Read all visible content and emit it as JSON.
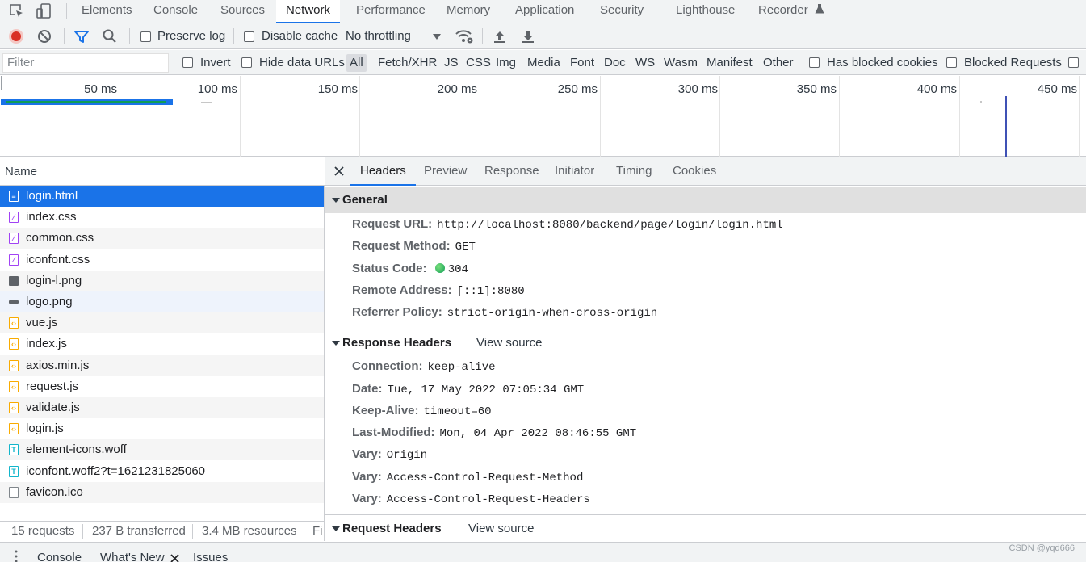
{
  "main_tabs": [
    "Elements",
    "Console",
    "Sources",
    "Network",
    "Performance",
    "Memory",
    "Application",
    "Security",
    "Lighthouse",
    "Recorder"
  ],
  "toolbar": {
    "preserve_log": "Preserve log",
    "disable_cache": "Disable cache",
    "throttling": "No throttling"
  },
  "filterbar": {
    "placeholder": "Filter",
    "invert": "Invert",
    "hide_data_urls": "Hide data URLs",
    "types": [
      "All",
      "Fetch/XHR",
      "JS",
      "CSS",
      "Img",
      "Media",
      "Font",
      "Doc",
      "WS",
      "Wasm",
      "Manifest",
      "Other"
    ],
    "has_blocked_cookies": "Has blocked cookies",
    "blocked_requests": "Blocked Requests"
  },
  "timeline": {
    "ticks": [
      "50 ms",
      "100 ms",
      "150 ms",
      "200 ms",
      "250 ms",
      "300 ms",
      "350 ms",
      "400 ms",
      "450 ms"
    ]
  },
  "request_list": {
    "header": "Name",
    "requests": [
      {
        "name": "login.html",
        "type": "doc"
      },
      {
        "name": "index.css",
        "type": "css"
      },
      {
        "name": "common.css",
        "type": "css"
      },
      {
        "name": "iconfont.css",
        "type": "css"
      },
      {
        "name": "login-l.png",
        "type": "img"
      },
      {
        "name": "logo.png",
        "type": "img"
      },
      {
        "name": "vue.js",
        "type": "js"
      },
      {
        "name": "index.js",
        "type": "js"
      },
      {
        "name": "axios.min.js",
        "type": "js"
      },
      {
        "name": "request.js",
        "type": "js"
      },
      {
        "name": "validate.js",
        "type": "js"
      },
      {
        "name": "login.js",
        "type": "js"
      },
      {
        "name": "element-icons.woff",
        "type": "font"
      },
      {
        "name": "iconfont.woff2?t=1621231825060",
        "type": "font"
      },
      {
        "name": "favicon.ico",
        "type": "other"
      }
    ]
  },
  "statusbar": {
    "requests": "15 requests",
    "transferred": "237 B transferred",
    "resources": "3.4 MB resources",
    "truncated": "Fi"
  },
  "details": {
    "tabs": [
      "Headers",
      "Preview",
      "Response",
      "Initiator",
      "Timing",
      "Cookies"
    ],
    "general": {
      "title": "General",
      "fields": [
        {
          "key": "Request URL:",
          "value": "http://localhost:8080/backend/page/login/login.html"
        },
        {
          "key": "Request Method:",
          "value": "GET"
        },
        {
          "key": "Status Code:",
          "value": "304"
        },
        {
          "key": "Remote Address:",
          "value": "[::1]:8080"
        },
        {
          "key": "Referrer Policy:",
          "value": "strict-origin-when-cross-origin"
        }
      ]
    },
    "response_headers": {
      "title": "Response Headers",
      "view_source": "View source",
      "fields": [
        {
          "key": "Connection:",
          "value": "keep-alive"
        },
        {
          "key": "Date:",
          "value": "Tue, 17 May 2022 07:05:34 GMT"
        },
        {
          "key": "Keep-Alive:",
          "value": "timeout=60"
        },
        {
          "key": "Last-Modified:",
          "value": "Mon, 04 Apr 2022 08:46:55 GMT"
        },
        {
          "key": "Vary:",
          "value": "Origin"
        },
        {
          "key": "Vary:",
          "value": "Access-Control-Request-Method"
        },
        {
          "key": "Vary:",
          "value": "Access-Control-Request-Headers"
        }
      ]
    },
    "request_headers": {
      "title": "Request Headers",
      "view_source": "View source"
    }
  },
  "drawer": {
    "tabs": [
      "Console",
      "What's New",
      "Issues"
    ]
  },
  "watermark": "CSDN @yqd666",
  "colors": {
    "accent": "#1a73e8",
    "record": "#d93025",
    "status_ok": "#0f9d58"
  }
}
